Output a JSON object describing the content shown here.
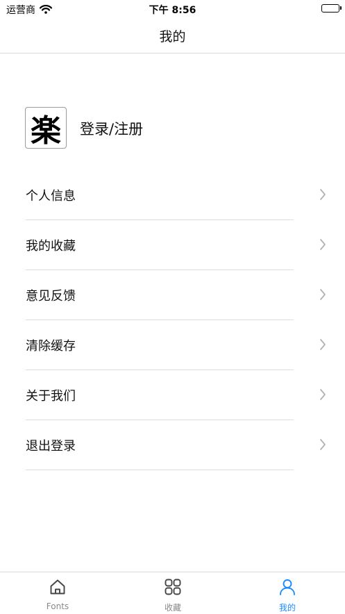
{
  "status_bar": {
    "carrier": "运营商",
    "time": "下午 8:56"
  },
  "nav": {
    "title": "我的"
  },
  "profile": {
    "avatar_glyph": "楽",
    "login_label": "登录/注册"
  },
  "menu": [
    {
      "label": "个人信息",
      "icon": "chevron-right-icon"
    },
    {
      "label": "我的收藏",
      "icon": "chevron-right-icon"
    },
    {
      "label": "意见反馈",
      "icon": "chevron-right-icon"
    },
    {
      "label": "清除缓存",
      "icon": "chevron-right-icon"
    },
    {
      "label": "关于我们",
      "icon": "chevron-right-icon"
    },
    {
      "label": "退出登录",
      "icon": "chevron-right-icon"
    }
  ],
  "tabs": [
    {
      "label": "Fonts",
      "icon": "home-icon",
      "active": false
    },
    {
      "label": "收藏",
      "icon": "grid-icon",
      "active": false
    },
    {
      "label": "我的",
      "icon": "person-icon",
      "active": true
    }
  ],
  "colors": {
    "accent": "#1a8cff",
    "inactive": "#888888",
    "divider": "#dedede"
  }
}
